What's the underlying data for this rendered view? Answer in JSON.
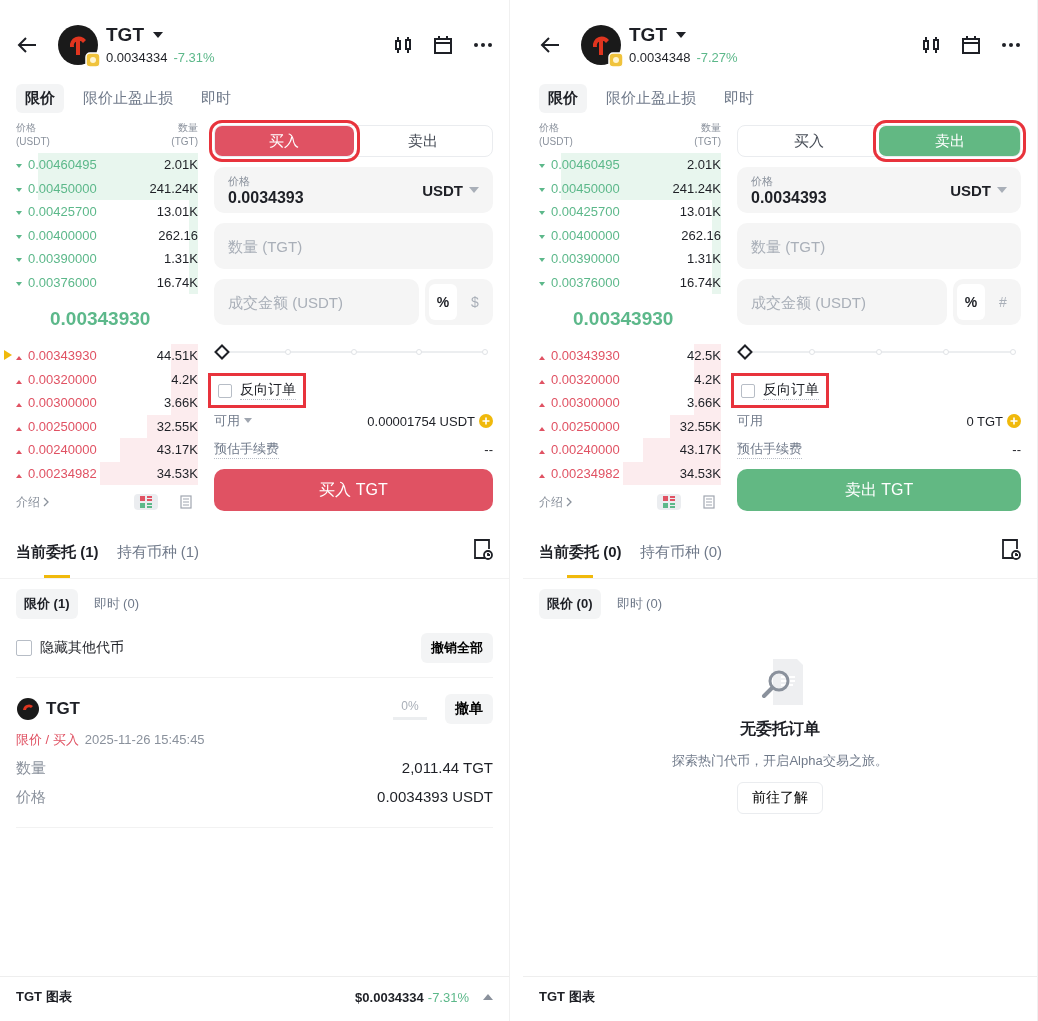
{
  "screens": [
    {
      "header": {
        "symbol": "TGT",
        "price": "0.0034334",
        "change": "-7.31%"
      },
      "order_types": [
        {
          "label": "限价",
          "selected": true
        },
        {
          "label": "限价止盈止损",
          "selected": false
        },
        {
          "label": "即时",
          "selected": false
        }
      ],
      "book": {
        "price_header": "价格",
        "price_unit": "(USDT)",
        "qty_header": "数量",
        "qty_unit": "(TGT)",
        "asks": [
          {
            "price": "0.00460495",
            "qty": "2.01K",
            "level": 0.88
          },
          {
            "price": "0.00450000",
            "qty": "241.24K",
            "level": 0.88
          },
          {
            "price": "0.00425700",
            "qty": "13.01K",
            "level": 0.05
          },
          {
            "price": "0.00400000",
            "qty": "262.16",
            "level": 0.05
          },
          {
            "price": "0.00390000",
            "qty": "1.31K",
            "level": 0.05
          },
          {
            "price": "0.00376000",
            "qty": "16.74K",
            "level": 0.05
          }
        ],
        "last_price": "0.00343930",
        "bids": [
          {
            "price": "0.00343930",
            "qty": "44.51K",
            "level": 0.15,
            "marked": true
          },
          {
            "price": "0.00320000",
            "qty": "4.2K",
            "level": 0.15,
            "marked": false
          },
          {
            "price": "0.00300000",
            "qty": "3.66K",
            "level": 0.15,
            "marked": false
          },
          {
            "price": "0.00250000",
            "qty": "32.55K",
            "level": 0.28,
            "marked": false
          },
          {
            "price": "0.00240000",
            "qty": "43.17K",
            "level": 0.43,
            "marked": false
          },
          {
            "price": "0.00234982",
            "qty": "34.53K",
            "level": 0.54,
            "marked": false
          }
        ],
        "intro": "介绍"
      },
      "view_modes": [
        {
          "kind": "depth",
          "selected": true
        },
        {
          "kind": "list",
          "selected": false
        }
      ],
      "side_tabs": [
        {
          "label": "买入",
          "selected": true,
          "highlighted": true
        },
        {
          "label": "卖出",
          "selected": false,
          "highlighted": false
        }
      ],
      "price_field": {
        "label": "价格",
        "value": "0.0034393",
        "unit": "USDT"
      },
      "qty_field": {
        "placeholder": "数量 (TGT)"
      },
      "amount_field": {
        "placeholder": "成交金额 (USDT)",
        "modes": [
          {
            "label": "%",
            "selected": true
          },
          {
            "label": "$",
            "selected": false
          }
        ]
      },
      "slider": {
        "level": 0
      },
      "reverse_order": {
        "label": "反向订单",
        "checked": false,
        "highlighted": true
      },
      "available": {
        "label": "可用",
        "dropdown": true,
        "value": "0.00001754 USDT"
      },
      "fee": {
        "label": "预估手续费",
        "value": "--"
      },
      "submit": {
        "label": "买入 TGT",
        "kind": "buy"
      },
      "orders": {
        "tabs": [
          {
            "label": "当前委托 (1)",
            "selected": true
          },
          {
            "label": "持有币种 (1)",
            "selected": false
          }
        ],
        "filters": [
          {
            "label": "限价 (1)",
            "selected": true
          },
          {
            "label": "即时 (0)",
            "selected": false
          }
        ],
        "hide_others": {
          "label": "隐藏其他代币",
          "checked": false
        },
        "cancel_all": "撤销全部",
        "items": [
          {
            "symbol": "TGT",
            "type": "限价 / 买入",
            "time": "2025-11-26 15:45:45",
            "filled": "0%",
            "level": 0,
            "cancel": "撤单",
            "fields": [
              {
                "label": "数量",
                "value": "2,011.44 TGT"
              },
              {
                "label": "价格",
                "value": "0.0034393 USDT"
              }
            ]
          }
        ]
      },
      "bottom_bar": {
        "label": "TGT 图表",
        "price": "$0.0034334",
        "change": "-7.31%"
      }
    },
    {
      "header": {
        "symbol": "TGT",
        "price": "0.0034348",
        "change": "-7.27%"
      },
      "order_types": [
        {
          "label": "限价",
          "selected": true
        },
        {
          "label": "限价止盈止损",
          "selected": false
        },
        {
          "label": "即时",
          "selected": false
        }
      ],
      "book": {
        "price_header": "价格",
        "price_unit": "(USDT)",
        "qty_header": "数量",
        "qty_unit": "(TGT)",
        "asks": [
          {
            "price": "0.00460495",
            "qty": "2.01K",
            "level": 0.88
          },
          {
            "price": "0.00450000",
            "qty": "241.24K",
            "level": 0.88
          },
          {
            "price": "0.00425700",
            "qty": "13.01K",
            "level": 0.05
          },
          {
            "price": "0.00400000",
            "qty": "262.16",
            "level": 0.05
          },
          {
            "price": "0.00390000",
            "qty": "1.31K",
            "level": 0.05
          },
          {
            "price": "0.00376000",
            "qty": "16.74K",
            "level": 0.05
          }
        ],
        "last_price": "0.00343930",
        "bids": [
          {
            "price": "0.00343930",
            "qty": "42.5K",
            "level": 0.15,
            "marked": false
          },
          {
            "price": "0.00320000",
            "qty": "4.2K",
            "level": 0.15,
            "marked": false
          },
          {
            "price": "0.00300000",
            "qty": "3.66K",
            "level": 0.15,
            "marked": false
          },
          {
            "price": "0.00250000",
            "qty": "32.55K",
            "level": 0.28,
            "marked": false
          },
          {
            "price": "0.00240000",
            "qty": "43.17K",
            "level": 0.43,
            "marked": false
          },
          {
            "price": "0.00234982",
            "qty": "34.53K",
            "level": 0.54,
            "marked": false
          }
        ],
        "intro": "介绍"
      },
      "view_modes": [
        {
          "kind": "depth",
          "selected": true
        },
        {
          "kind": "list",
          "selected": false
        }
      ],
      "side_tabs": [
        {
          "label": "买入",
          "selected": false,
          "highlighted": false
        },
        {
          "label": "卖出",
          "selected": true,
          "highlighted": true
        }
      ],
      "price_field": {
        "label": "价格",
        "value": "0.0034393",
        "unit": "USDT"
      },
      "qty_field": {
        "placeholder": "数量 (TGT)"
      },
      "amount_field": {
        "placeholder": "成交金额 (USDT)",
        "modes": [
          {
            "label": "%",
            "selected": true
          },
          {
            "label": "#",
            "selected": false
          }
        ]
      },
      "slider": {
        "level": 0
      },
      "reverse_order": {
        "label": "反向订单",
        "checked": false,
        "highlighted": true
      },
      "available": {
        "label": "可用",
        "dropdown": false,
        "value": "0 TGT"
      },
      "fee": {
        "label": "预估手续费",
        "value": "--"
      },
      "submit": {
        "label": "卖出 TGT",
        "kind": "sell"
      },
      "orders": {
        "tabs": [
          {
            "label": "当前委托 (0)",
            "selected": true
          },
          {
            "label": "持有币种 (0)",
            "selected": false
          }
        ],
        "filters": [
          {
            "label": "限价 (0)",
            "selected": true
          },
          {
            "label": "即时 (0)",
            "selected": false
          }
        ],
        "empty": {
          "title": "无委托订单",
          "text": "探索热门代币，开启Alpha交易之旅。",
          "button": "前往了解"
        }
      },
      "bottom_bar": {
        "label": "TGT 图表"
      }
    }
  ]
}
